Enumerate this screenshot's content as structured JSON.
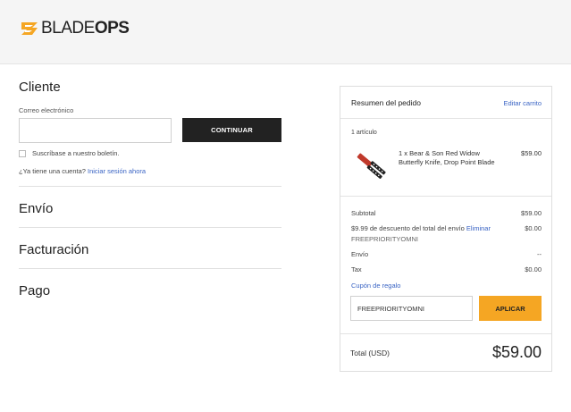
{
  "header": {
    "brand_light": "BLADE",
    "brand_bold": "OPS"
  },
  "customer": {
    "title": "Cliente",
    "email_label": "Correo electrónico",
    "email_value": "",
    "continue_label": "CONTINUAR",
    "newsletter_label": "Suscríbase a nuestro boletín.",
    "account_question": "¿Ya tiene una cuenta?",
    "login_link": "Iniciar sesión ahora"
  },
  "sections": {
    "shipping": "Envío",
    "billing": "Facturación",
    "payment": "Pago"
  },
  "summary": {
    "title": "Resumen del pedido",
    "edit_link": "Editar carrito",
    "items_count": "1 artículo",
    "product": {
      "name": "1 x Bear & Son Red Widow Butterfly Knife, Drop Point Blade",
      "price": "$59.00"
    },
    "subtotal_label": "Subtotal",
    "subtotal_value": "$59.00",
    "discount_label": "$9.99 de descuento del total del envío",
    "discount_remove": "Eliminar",
    "discount_value": "$0.00",
    "coupon_code": "FREEPRIORITYOMNI",
    "shipping_label": "Envío",
    "shipping_value": "--",
    "tax_label": "Tax",
    "tax_value": "$0.00",
    "gift_link": "Cupón de regalo",
    "coupon_input_value": "FREEPRIORITYOMNI",
    "apply_label": "APLICAR",
    "total_label": "Total (USD)",
    "total_value": "$59.00"
  },
  "colors": {
    "accent": "#f5a623",
    "link": "#3a64c4",
    "button_dark": "#222222"
  }
}
